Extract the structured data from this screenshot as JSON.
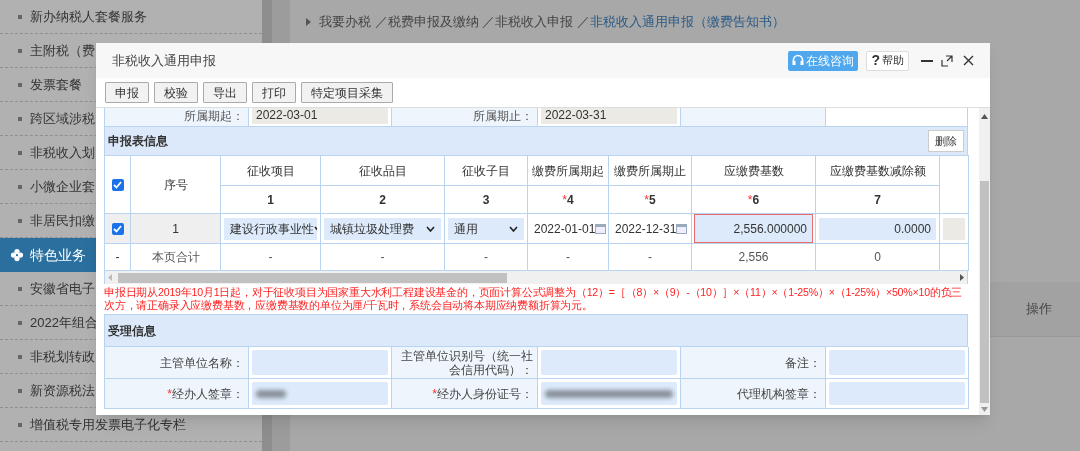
{
  "sidebar": {
    "items": [
      {
        "label": "新办纳税人套餐服务",
        "selected": false
      },
      {
        "label": "主附税（费",
        "selected": false
      },
      {
        "label": "发票套餐",
        "selected": false
      },
      {
        "label": "跨区域涉税",
        "selected": false
      },
      {
        "label": "非税收入划",
        "selected": false
      },
      {
        "label": "小微企业套",
        "selected": false
      },
      {
        "label": "非居民扣缴",
        "selected": false
      },
      {
        "label": "特色业务",
        "selected": true
      },
      {
        "label": "安徽省电子",
        "selected": false
      },
      {
        "label": "2022年组合",
        "selected": false
      },
      {
        "label": "非税划转政",
        "selected": false
      },
      {
        "label": "新资源税法",
        "selected": false
      },
      {
        "label": "增值税专用发票电子化专栏",
        "selected": false
      }
    ]
  },
  "breadcrumb": {
    "path": "我要办税 ／税费申报及缴纳 ／非税收入申报 ／",
    "current": "非税收入通用申报（缴费告知书）"
  },
  "background_table": {
    "columns": [
      "操作"
    ]
  },
  "dialog": {
    "title": "非税收入通用申报",
    "header_buttons": [
      {
        "kind": "consult",
        "label": "在线咨询"
      },
      {
        "kind": "help",
        "icon": "?",
        "label": "帮助"
      },
      {
        "kind": "minimize"
      },
      {
        "kind": "maximize"
      },
      {
        "kind": "close"
      }
    ],
    "toolbar": [
      "申报",
      "校验",
      "导出",
      "打印",
      "特定项目采集"
    ],
    "period": [
      {
        "label": "所属期起：",
        "value": "2022-03-01"
      },
      {
        "label": "所属期止：",
        "value": "2022-03-31"
      }
    ],
    "declaration": {
      "title": "申报表信息",
      "delete_button": "删除",
      "header_checked": true,
      "index_header": "序号",
      "columns": [
        {
          "label": "征收项目",
          "number": "1"
        },
        {
          "label": "征收品目",
          "number": "2"
        },
        {
          "label": "征收子目",
          "number": "3"
        },
        {
          "label": "缴费所属期起",
          "mark": "*",
          "number": "4"
        },
        {
          "label": "缴费所属期止",
          "mark": "*",
          "number": "5"
        },
        {
          "label": "应缴费基数",
          "mark": "*",
          "number": "6"
        },
        {
          "label": "应缴费基数减除额",
          "number": "7"
        }
      ],
      "rows": [
        {
          "checked": true,
          "index": "1",
          "cells": [
            {
              "kind": "select",
              "value": "建设行政事业性"
            },
            {
              "kind": "select",
              "value": "城镇垃圾处理费"
            },
            {
              "kind": "select",
              "value": "通用"
            },
            {
              "kind": "date",
              "value": "2022-01-01"
            },
            {
              "kind": "date",
              "value": "2022-12-31"
            },
            {
              "kind": "number",
              "value": "2,556.000000",
              "highlighted": true
            },
            {
              "kind": "number",
              "value": "0.0000",
              "highlighted": false
            },
            {
              "kind": "disabled"
            }
          ]
        }
      ],
      "total_row": {
        "first": "-",
        "label": "本页合计",
        "cells": [
          "-",
          "-",
          "-",
          "-",
          "-",
          "2,556",
          "0"
        ]
      }
    },
    "notice": "申报日期从2019年10月1日起，对于征收项目为国家重大水利工程建设基金的，页面计算公式调整为（12）=［（8）×（9）-（10）］×（11）×（1-25%）×（1-25%）×50%×10的负三次方，请正确录入应缴费基数，应缴费基数的单位为厘/千瓦时，系统会自动将本期应纳费额折算为元。",
    "acceptance": {
      "title": "受理信息",
      "fields": [
        {
          "label": "主管单位名称：",
          "redacted": false
        },
        {
          "label": "主管单位识别号（统一社会信用代码）：",
          "redacted": false
        },
        {
          "label": "备注：",
          "redacted": false
        },
        {
          "mark": "*",
          "label": "经办人签章：",
          "redacted": true
        },
        {
          "mark": "*",
          "label": "经办人身份证号：",
          "redacted": true
        },
        {
          "label": "代理机构签章：",
          "redacted": false
        }
      ]
    }
  }
}
